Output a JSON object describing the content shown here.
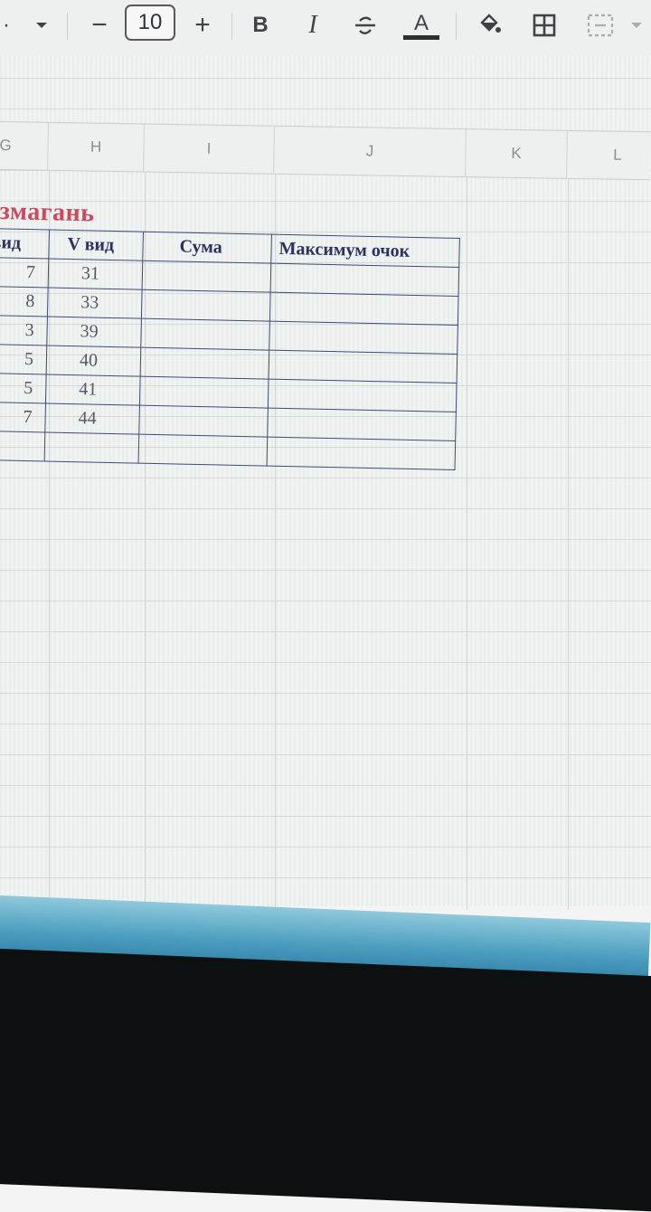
{
  "toolbar": {
    "font_size": "10",
    "decrease_label": "−",
    "increase_label": "+",
    "bold_label": "B",
    "italic_label": "I",
    "text_color_label": "A"
  },
  "columns": [
    "G",
    "H",
    "I",
    "J",
    "K",
    "L"
  ],
  "table": {
    "title": "змагань",
    "headers": [
      "вид",
      "V вид",
      "Сума",
      "Максимум очок"
    ],
    "rows": [
      [
        "7",
        "31",
        "",
        ""
      ],
      [
        "8",
        "33",
        "",
        ""
      ],
      [
        "3",
        "39",
        "",
        ""
      ],
      [
        "5",
        "40",
        "",
        ""
      ],
      [
        "5",
        "41",
        "",
        ""
      ],
      [
        "7",
        "44",
        "",
        ""
      ],
      [
        "",
        "",
        "",
        ""
      ]
    ]
  },
  "colors": {
    "title": "#d0485f",
    "table_border": "#3e4a78",
    "screen_edge": "#4d9fc0"
  }
}
